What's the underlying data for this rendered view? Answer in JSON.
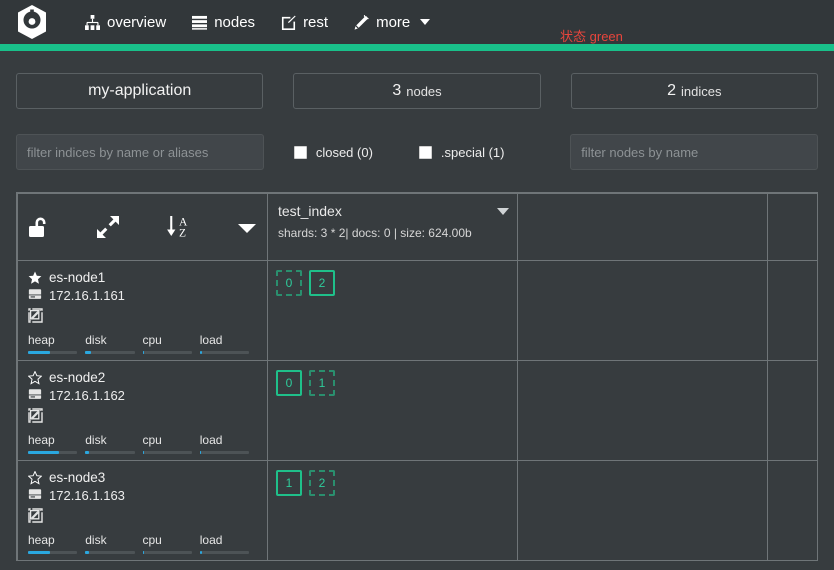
{
  "navbar": {
    "logo_name": "cerebro-logo",
    "items": [
      {
        "label": "overview",
        "icon": "sitemap-icon"
      },
      {
        "label": "nodes",
        "icon": "server-list-icon"
      },
      {
        "label": "rest",
        "icon": "edit-square-icon"
      },
      {
        "label": "more",
        "icon": "magic-wand-icon",
        "caret": true
      }
    ],
    "cluster_status_label": "状态",
    "cluster_status_value": "green",
    "status_color": "#19c08a",
    "status_text_color": "#e8453c"
  },
  "overview": {
    "cluster_name": "my-application",
    "nodes_count": "3",
    "nodes_label": "nodes",
    "indices_count": "2",
    "indices_label": "indices",
    "index_filter_placeholder": "filter indices by name or aliases",
    "index_filter_value": "",
    "node_filter_placeholder": "filter nodes by name",
    "node_filter_value": "",
    "checkboxes": [
      {
        "label": "closed (0)",
        "checked": false
      },
      {
        "label": ".special (1)",
        "checked": false
      }
    ]
  },
  "table": {
    "tools": [
      {
        "name": "unlock-icon",
        "title": "unlock"
      },
      {
        "name": "expand-arrows-icon",
        "title": "expand"
      },
      {
        "name": "sort-alpha-icon",
        "title": "sort a-z"
      },
      {
        "name": "chevron-down-icon",
        "title": "more"
      }
    ],
    "index_header": {
      "name": "test_index",
      "meta": "shards: 3 * 2| docs: 0 | size: 624.00b"
    },
    "nodes": [
      {
        "name": "es-node1",
        "ip": "172.16.1.161",
        "master": true,
        "star_icon": "star-filled-icon",
        "host_icon": "hdd-icon",
        "extra_icon": "broken-image-icon",
        "metrics": [
          {
            "label": "heap",
            "percent": 45
          },
          {
            "label": "disk",
            "percent": 11
          },
          {
            "label": "cpu",
            "percent": 1
          },
          {
            "label": "load",
            "percent": 5
          }
        ],
        "shards": [
          {
            "num": "0",
            "type": "replica"
          },
          {
            "num": "2",
            "type": "primary"
          }
        ]
      },
      {
        "name": "es-node2",
        "ip": "172.16.1.162",
        "master": false,
        "star_icon": "star-outline-icon",
        "host_icon": "hdd-icon",
        "extra_icon": "broken-image-icon",
        "metrics": [
          {
            "label": "heap",
            "percent": 62
          },
          {
            "label": "disk",
            "percent": 8
          },
          {
            "label": "cpu",
            "percent": 1
          },
          {
            "label": "load",
            "percent": 1
          }
        ],
        "shards": [
          {
            "num": "0",
            "type": "primary"
          },
          {
            "num": "1",
            "type": "replica"
          }
        ]
      },
      {
        "name": "es-node3",
        "ip": "172.16.1.163",
        "master": false,
        "star_icon": "star-outline-icon",
        "host_icon": "hdd-icon",
        "extra_icon": "broken-image-icon",
        "metrics": [
          {
            "label": "heap",
            "percent": 44
          },
          {
            "label": "disk",
            "percent": 8
          },
          {
            "label": "cpu",
            "percent": 1
          },
          {
            "label": "load",
            "percent": 4
          }
        ],
        "shards": [
          {
            "num": "1",
            "type": "primary"
          },
          {
            "num": "2",
            "type": "replica"
          }
        ]
      }
    ]
  }
}
